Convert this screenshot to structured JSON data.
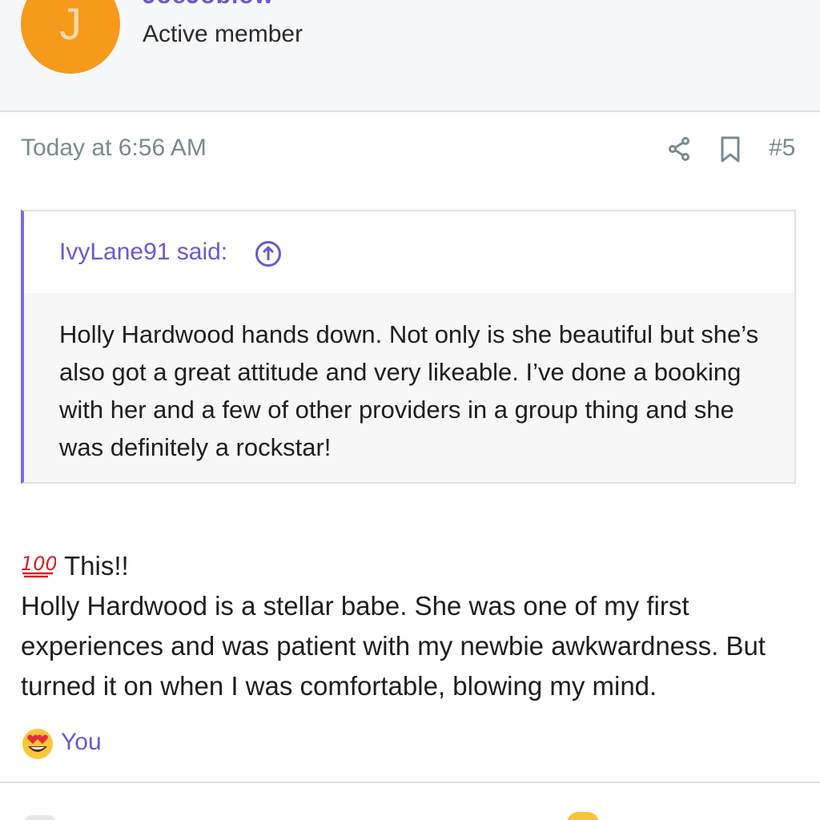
{
  "user": {
    "avatar_letter": "J",
    "name": "JoeJoblow",
    "title": "Active member"
  },
  "post": {
    "date": "Today at 6:56 AM",
    "number": "#5",
    "icons": [
      "share-icon",
      "bookmark-icon"
    ]
  },
  "quote": {
    "author_label": "IvyLane91 said:",
    "text": "Holly Hardwood hands down. Not only is she beautiful but she’s also got a great attitude and very likeable. I’ve done a booking with her and a few of other providers in a group thing and she was definitely a rockstar!"
  },
  "body": {
    "line1": "This!!",
    "paragraph": "Holly Hardwood is a stellar babe. She was one of my first experiences and was patient with my newbie awkwardness. But turned it on when I was comfortable, blowing my mind."
  },
  "reactions": {
    "user": "You",
    "emoji": "heart-eyes-emoji"
  },
  "colors": {
    "accent": "#6a5acd",
    "avatar_bg": "#f59a1b",
    "meta_text": "#7b8a8f"
  }
}
